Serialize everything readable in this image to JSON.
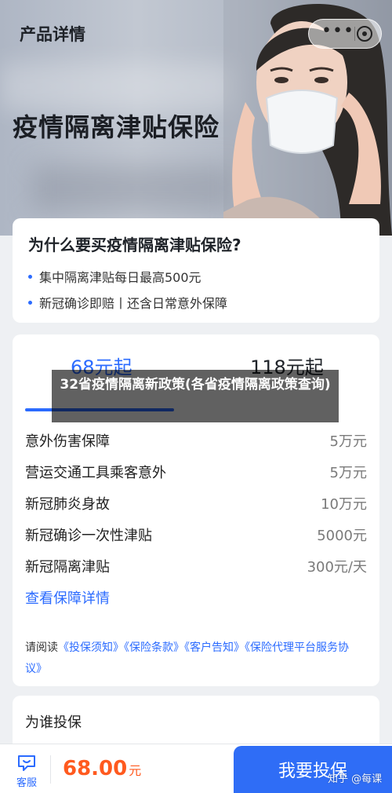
{
  "header": {
    "title": "产品详情",
    "more_label": "•••"
  },
  "hero": {
    "title": "疫情隔离津贴保险"
  },
  "why": {
    "title": "为什么要买疫情隔离津贴保险?",
    "bullets": [
      "集中隔离津贴每日最高500元",
      "新冠确诊即赔丨还含日常意外保障"
    ]
  },
  "plans": {
    "tabs": [
      {
        "label": "68元起",
        "active": true
      },
      {
        "label": "118元起",
        "active": false
      }
    ],
    "coverage": [
      {
        "item": "意外伤害保障",
        "amount": "5万元"
      },
      {
        "item": "营运交通工具乘客意外",
        "amount": "5万元"
      },
      {
        "item": "新冠肺炎身故",
        "amount": "10万元"
      },
      {
        "item": "新冠确诊一次性津贴",
        "amount": "5000元"
      },
      {
        "item": "新冠隔离津贴",
        "amount": "300元/天"
      }
    ],
    "details_link": "查看保障详情",
    "agreement": {
      "prefix": "请阅读",
      "docs": [
        "《投保须知》",
        "《保险条款》",
        "《客户告知》",
        "《保险代理平台服务协议》"
      ]
    }
  },
  "who": {
    "title": "为谁投保"
  },
  "bottom_bar": {
    "service_label": "客服",
    "price_value": "68.00",
    "price_unit": "元",
    "buy_label": "我要投保"
  },
  "overlay_caption": "32省疫情隔离新政策(各省疫情隔离政策查询)",
  "watermark": "知乎 @每课",
  "colors": {
    "accent": "#2b6bff",
    "price": "#ff5a1f",
    "buy_button": "#2f6df6"
  }
}
